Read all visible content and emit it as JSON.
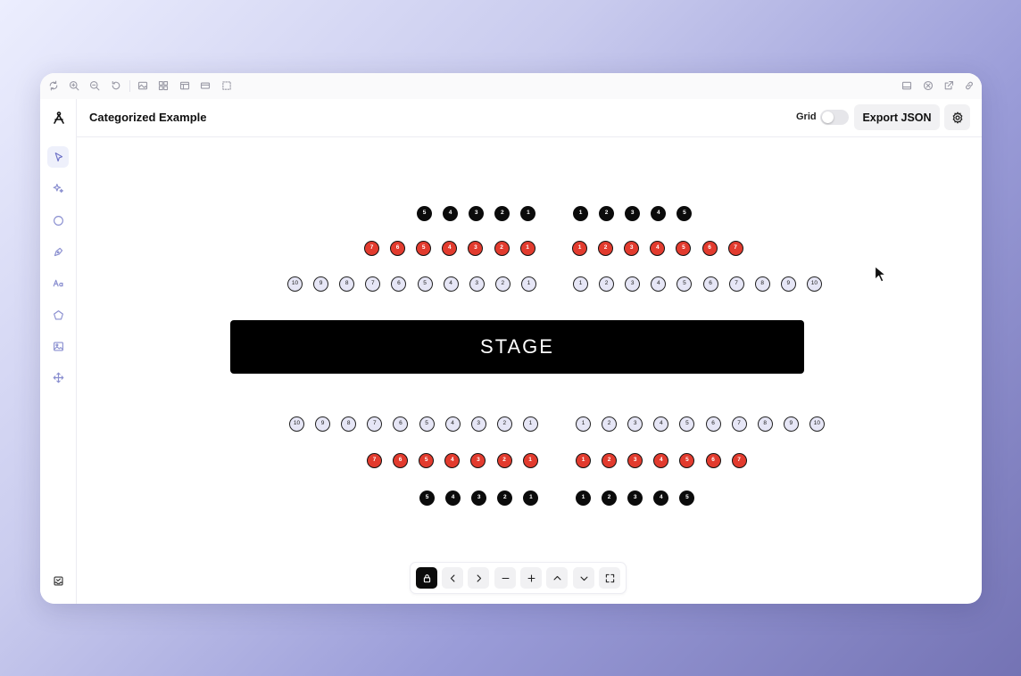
{
  "header": {
    "title": "Categorized Example",
    "grid_label": "Grid",
    "grid_enabled": false,
    "export_label": "Export JSON"
  },
  "window_toolbar": {
    "left_icons": [
      "refresh-icon",
      "zoom-in-icon",
      "zoom-out-icon",
      "reset-icon",
      "image-icon",
      "grid-icon",
      "layout-icon",
      "card-icon",
      "select-icon"
    ],
    "right_icons": [
      "panel-icon",
      "close-circle-icon",
      "external-link-icon",
      "link-icon"
    ]
  },
  "sidebar": {
    "tools": [
      "select-icon",
      "sparkle-icon",
      "circle-icon",
      "pen-icon",
      "text-icon",
      "polygon-icon",
      "image-icon",
      "move-icon"
    ],
    "active_tool": "select-icon",
    "bottom_tool": "inbox-icon"
  },
  "stage_label": "STAGE",
  "seating": {
    "colors": {
      "black": "#0b0b0b",
      "red": "#e23b2e",
      "lavender": "#e6e6f6"
    },
    "top_left": {
      "row_black": [
        "5",
        "4",
        "3",
        "2",
        "1"
      ],
      "row_red": [
        "7",
        "6",
        "5",
        "4",
        "3",
        "2",
        "1"
      ],
      "row_lavender": [
        "10",
        "9",
        "8",
        "7",
        "6",
        "5",
        "4",
        "3",
        "2",
        "1"
      ]
    },
    "top_right": {
      "row_black": [
        "1",
        "2",
        "3",
        "4",
        "5"
      ],
      "row_red": [
        "1",
        "2",
        "3",
        "4",
        "5",
        "6",
        "7"
      ],
      "row_lavender": [
        "1",
        "2",
        "3",
        "4",
        "5",
        "6",
        "7",
        "8",
        "9",
        "10"
      ]
    },
    "bottom_left": {
      "row_lavender": [
        "10",
        "9",
        "8",
        "7",
        "6",
        "5",
        "4",
        "3",
        "2",
        "1"
      ],
      "row_red": [
        "7",
        "6",
        "5",
        "4",
        "3",
        "2",
        "1"
      ],
      "row_black": [
        "5",
        "4",
        "3",
        "2",
        "1"
      ]
    },
    "bottom_right": {
      "row_lavender": [
        "1",
        "2",
        "3",
        "4",
        "5",
        "6",
        "7",
        "8",
        "9",
        "10"
      ],
      "row_red": [
        "1",
        "2",
        "3",
        "4",
        "5",
        "6",
        "7"
      ],
      "row_black": [
        "1",
        "2",
        "3",
        "4",
        "5"
      ]
    }
  },
  "bottom_toolbar": {
    "buttons": [
      "lock-icon",
      "chevron-left-icon",
      "chevron-right-icon",
      "minus-icon",
      "plus-icon",
      "chevron-up-icon",
      "chevron-down-icon",
      "fullscreen-icon"
    ]
  }
}
